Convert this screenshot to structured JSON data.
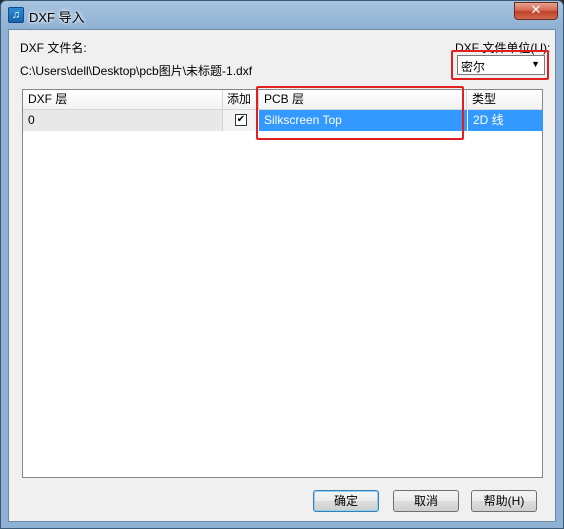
{
  "window": {
    "title": "DXF 导入",
    "close_symbol": "✕",
    "app_icon": "music-note-icon"
  },
  "file": {
    "label": "DXF 文件名:",
    "path": "C:\\Users\\dell\\Desktop\\pcb图片\\未标题-1.dxf"
  },
  "units": {
    "label": "DXF 文件单位(U):",
    "value": "密尔",
    "arrow": "▼"
  },
  "grid": {
    "columns": [
      "DXF 层",
      "添加",
      "PCB 层",
      "类型"
    ],
    "rows": [
      {
        "dxf_layer": "0",
        "add": true,
        "check_mark": "✔",
        "pcb_layer": "Silkscreen Top",
        "type": "2D 线"
      }
    ]
  },
  "buttons": {
    "ok": "确定",
    "cancel": "取消",
    "help": "帮助(H)"
  },
  "colors": {
    "selection": "#3399ff",
    "highlight": "#e02020"
  }
}
